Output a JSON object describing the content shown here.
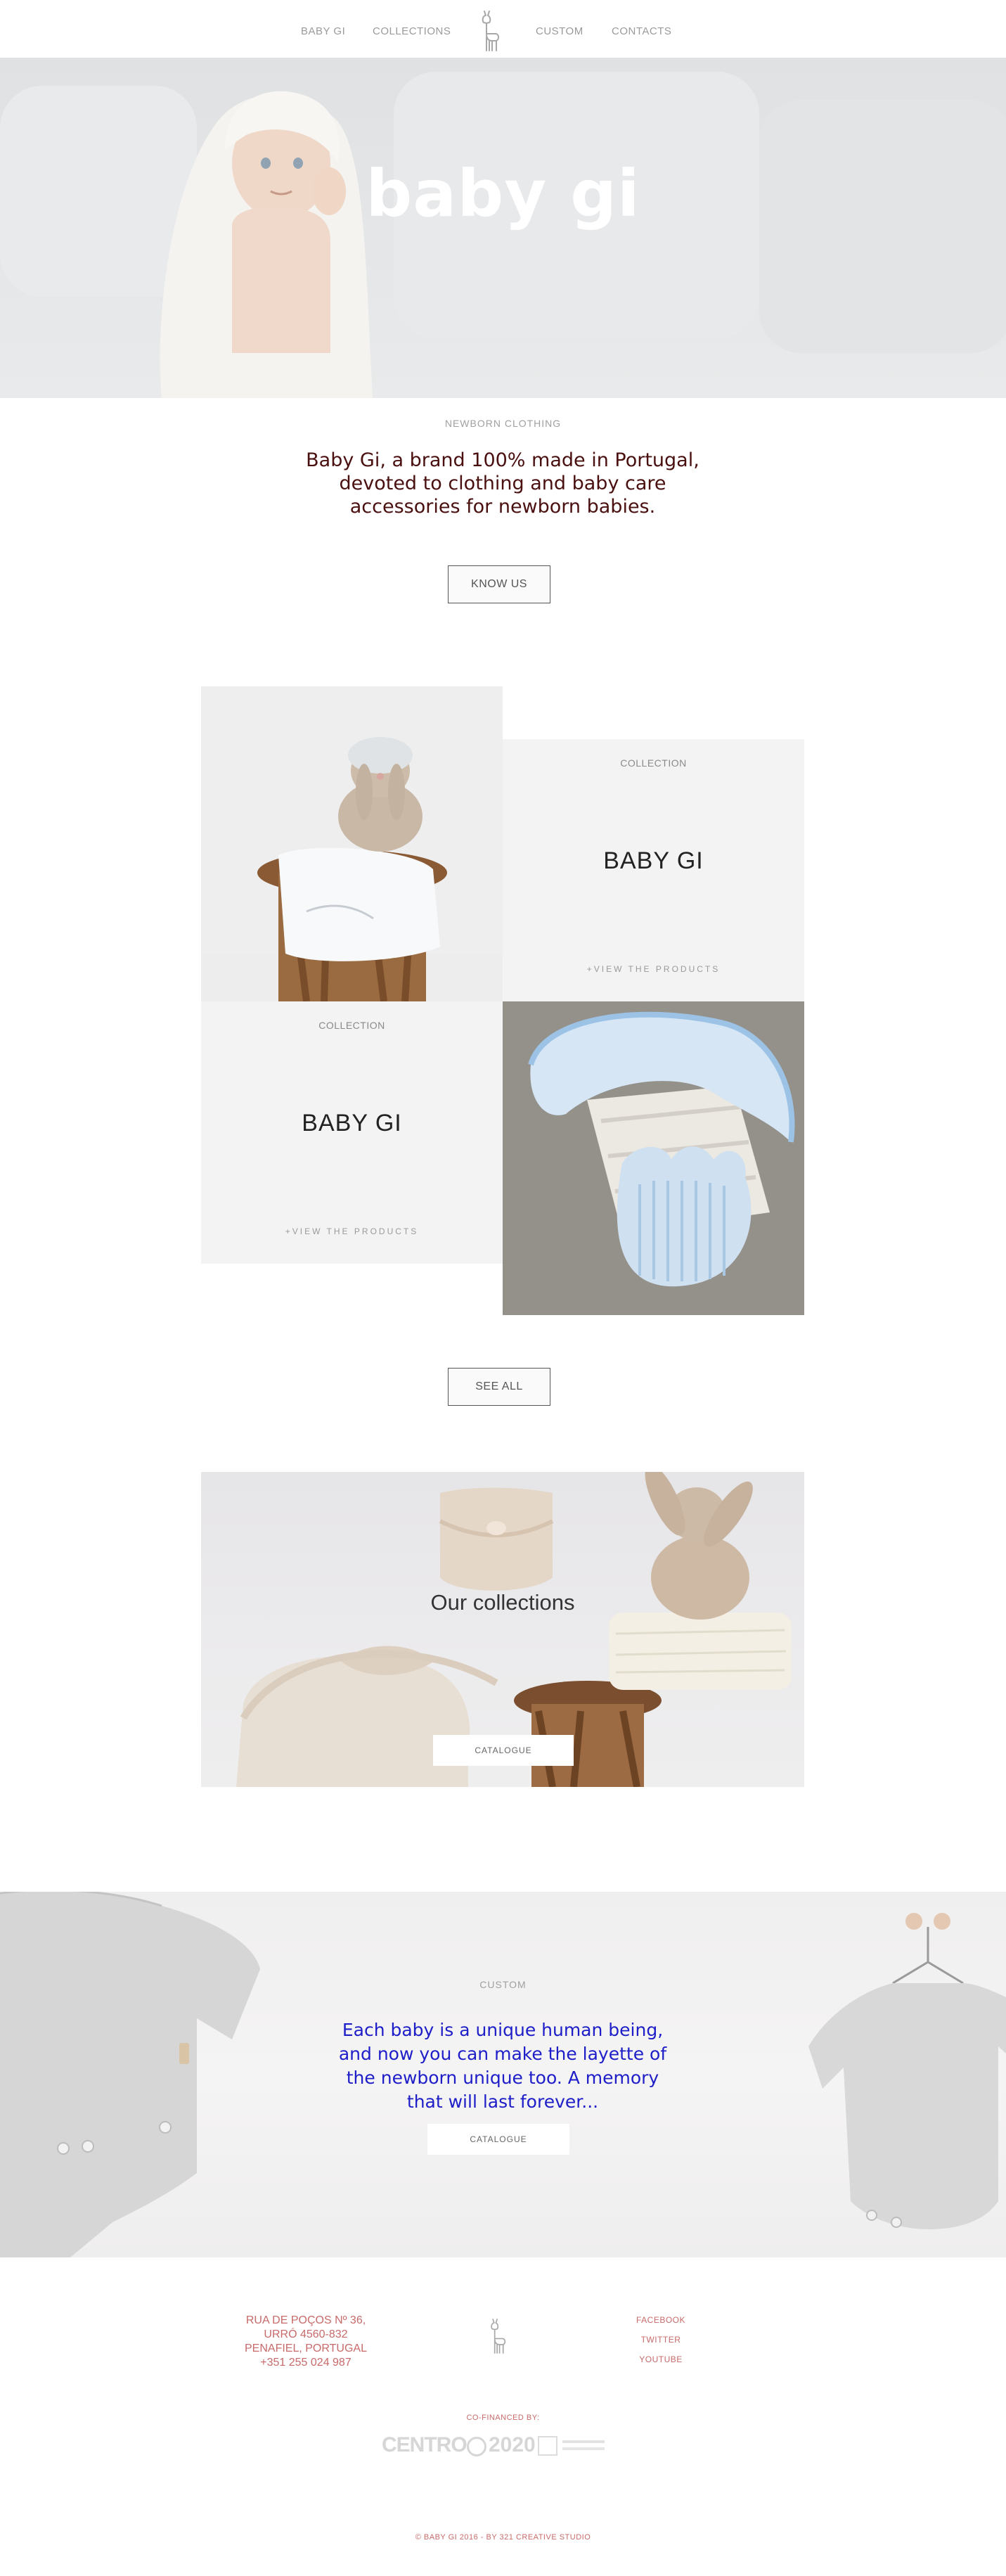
{
  "nav": {
    "items": [
      {
        "label": "BABY GI"
      },
      {
        "label": "COLLECTIONS"
      },
      {
        "label": "CUSTOM"
      },
      {
        "label": "CONTACTS"
      }
    ]
  },
  "hero": {
    "title": "baby gi"
  },
  "intro": {
    "eyebrow": "NEWBORN  CLOTHING",
    "text": "Baby Gi, a brand 100% made in Portugal, devoted to clothing and baby care accessories for newborn babies.",
    "button_label": "KNOW US"
  },
  "collections": {
    "cards": [
      {
        "eyebrow": "COLLECTION",
        "title": "BABY GI",
        "link": "+VIEW  THE  PRODUCTS"
      },
      {
        "eyebrow": "COLLECTION",
        "title": "BABY GI",
        "link": "+VIEW  THE  PRODUCTS"
      }
    ],
    "see_all_label": "SEE ALL"
  },
  "our_collections": {
    "heading": "Our collections",
    "button_label": "CATALOGUE"
  },
  "custom": {
    "eyebrow": "CUSTOM",
    "text": "Each baby is a unique human being, and now you can make the layette of the newborn unique too. A memory that will last forever...",
    "button_label": "CATALOGUE"
  },
  "footer": {
    "address": [
      "RUA DE POÇOS Nº 36,",
      "URRÓ 4560-832",
      "PENAFIEL, PORTUGAL",
      "+351 255 024 987"
    ],
    "social": [
      {
        "label": "FACEBOOK"
      },
      {
        "label": "TWITTER"
      },
      {
        "label": "YOUTUBE"
      }
    ],
    "cofinanced_label": "CO-FINANCED BY:",
    "sponsors": [
      "CENTRO",
      "2020"
    ],
    "copyright": "© BABY GI 2016 - BY 321 CREATIVE STUDIO"
  },
  "colors": {
    "accent_text": "#4a1010",
    "custom_text": "#1e1ec8",
    "footer_text": "#c86a6a",
    "card_bg": "#f3f3f3"
  },
  "icons": [
    "llama-logo-icon"
  ]
}
